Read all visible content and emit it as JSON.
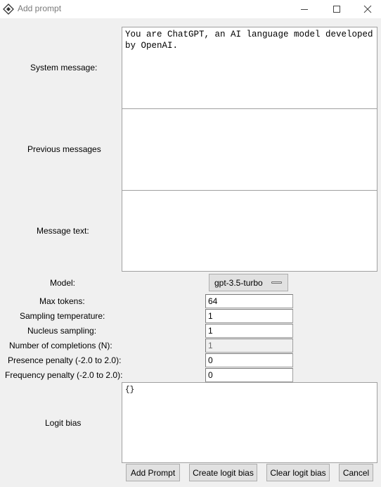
{
  "window": {
    "title": "Add prompt"
  },
  "fields": {
    "system_label": "System message:",
    "system_value": "You are ChatGPT, an AI language model developed by OpenAI.",
    "previous_label": "Previous messages",
    "previous_value": "",
    "message_label": "Message text:",
    "message_value": "",
    "model_label": "Model:",
    "model_value": "gpt-3.5-turbo",
    "max_tokens_label": "Max tokens:",
    "max_tokens_value": "64",
    "temperature_label": "Sampling temperature:",
    "temperature_value": "1",
    "nucleus_label": "Nucleus sampling:",
    "nucleus_value": "1",
    "completions_label": "Number of completions (N):",
    "completions_value": "1",
    "presence_label": "Presence penalty (-2.0 to 2.0):",
    "presence_value": "0",
    "frequency_label": "Frequency penalty (-2.0 to 2.0):",
    "frequency_value": "0",
    "logit_label": "Logit bias",
    "logit_value": "{}"
  },
  "buttons": {
    "add_prompt": "Add Prompt",
    "create_logit_bias": "Create logit bias",
    "clear_logit_bias": "Clear logit bias",
    "cancel": "Cancel"
  }
}
